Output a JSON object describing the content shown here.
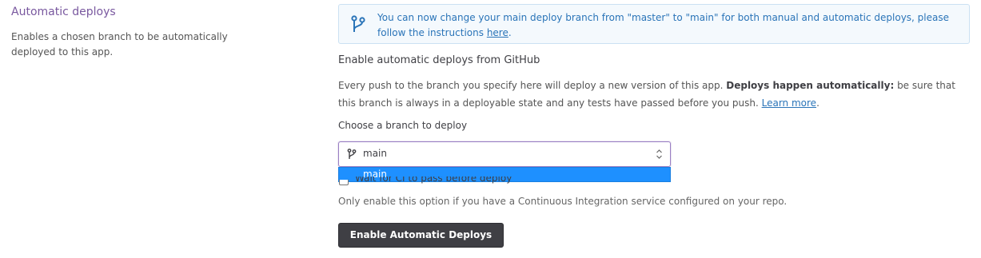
{
  "left": {
    "title": "Automatic deploys",
    "description": "Enables a chosen branch to be automatically deployed to this app."
  },
  "notice": {
    "icon": "git-branch-icon",
    "text_before": "You can now change your main deploy branch from \"master\" to \"main\" for both manual and automatic deploys, please follow the instructions ",
    "link_text": "here",
    "text_after": "."
  },
  "section": {
    "title": "Enable automatic deploys from GitHub",
    "desc_1": "Every push to the branch you specify here will deploy a new version of this app. ",
    "desc_bold": "Deploys happen automatically:",
    "desc_2": " be sure that this branch is always in a deployable state and any tests have passed before you push. ",
    "desc_link": "Learn more",
    "desc_end": "."
  },
  "branch_select": {
    "label": "Choose a branch to deploy",
    "value": "main",
    "options": [
      "main"
    ],
    "highlighted_option": "main"
  },
  "ci_checkbox": {
    "label": "Wait for CI to pass before deploy",
    "checked": false,
    "helper": "Only enable this option if you have a Continuous Integration service configured on your repo."
  },
  "enable_button": {
    "label": "Enable Automatic Deploys"
  },
  "colors": {
    "accent": "#79589f",
    "info_text": "#2a74b8",
    "info_bg": "#f4f9fd",
    "dropdown_highlight": "#1e90ff",
    "button_bg": "#3f3f44"
  }
}
